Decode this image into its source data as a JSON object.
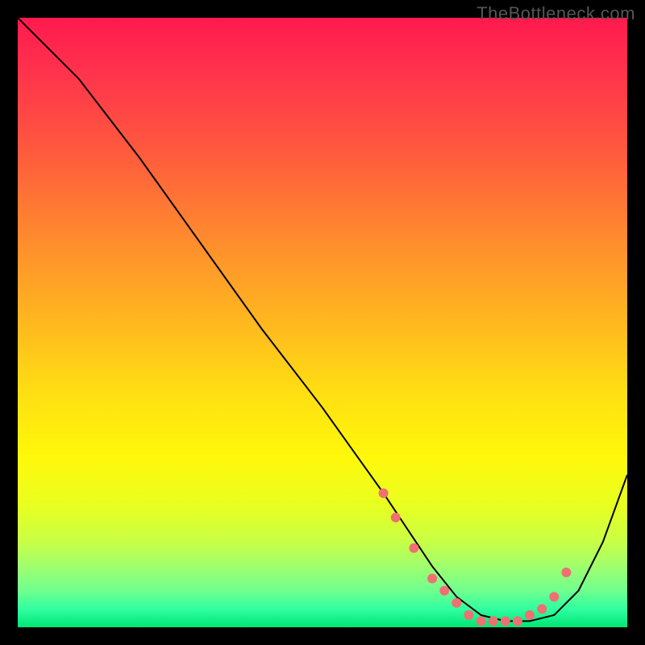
{
  "watermark": "TheBottleneck.com",
  "chart_data": {
    "type": "line",
    "title": "",
    "xlabel": "",
    "ylabel": "",
    "xlim": [
      0,
      100
    ],
    "ylim": [
      0,
      100
    ],
    "grid": false,
    "legend": false,
    "series": [
      {
        "name": "curve",
        "x": [
          0,
          5,
          10,
          20,
          30,
          40,
          50,
          55,
          60,
          64,
          68,
          72,
          76,
          80,
          84,
          88,
          92,
          96,
          100
        ],
        "y": [
          100,
          95,
          90,
          77,
          63,
          49,
          36,
          29,
          22,
          16,
          10,
          5,
          2,
          1,
          1,
          2,
          6,
          14,
          25
        ]
      }
    ],
    "markers": {
      "name": "dots",
      "color": "#ef6f72",
      "x": [
        60,
        62,
        65,
        68,
        70,
        72,
        74,
        76,
        78,
        80,
        82,
        84,
        86,
        88,
        90
      ],
      "y": [
        22,
        18,
        13,
        8,
        6,
        4,
        2,
        1,
        1,
        1,
        1,
        2,
        3,
        5,
        9
      ]
    },
    "gradient_stops": [
      {
        "pct": 0,
        "color": "#ff1a4d"
      },
      {
        "pct": 8,
        "color": "#ff304d"
      },
      {
        "pct": 22,
        "color": "#ff5a3d"
      },
      {
        "pct": 36,
        "color": "#ff8a2e"
      },
      {
        "pct": 50,
        "color": "#ffb81f"
      },
      {
        "pct": 62,
        "color": "#ffe012"
      },
      {
        "pct": 72,
        "color": "#fff80a"
      },
      {
        "pct": 80,
        "color": "#e8ff20"
      },
      {
        "pct": 86,
        "color": "#c8ff46"
      },
      {
        "pct": 90,
        "color": "#a0ff6e"
      },
      {
        "pct": 94,
        "color": "#70ff8e"
      },
      {
        "pct": 97,
        "color": "#30ffa0"
      },
      {
        "pct": 100,
        "color": "#00e676"
      }
    ]
  }
}
